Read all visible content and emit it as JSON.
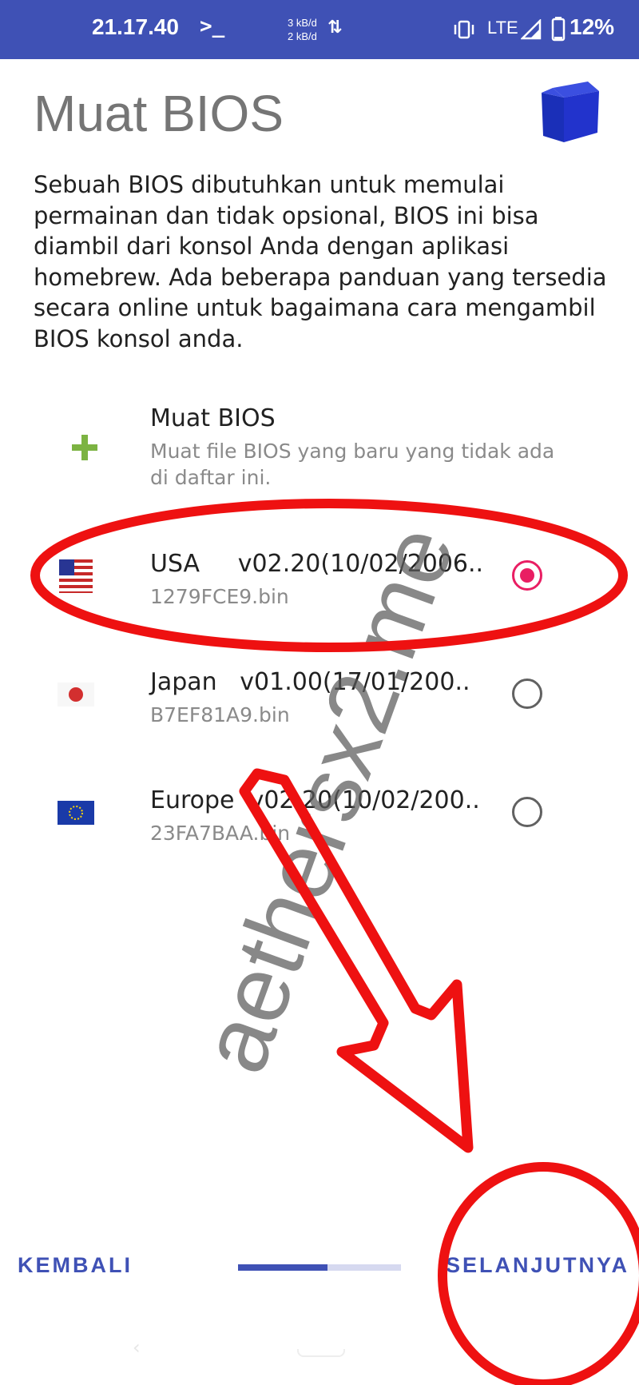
{
  "status_bar": {
    "time": "21.17.40",
    "terminal_glyph": ">_",
    "upload_speed": "3 kB/d",
    "download_speed": "2 kB/d",
    "network": "LTE",
    "battery": "12%",
    "icons": [
      "terminal-icon",
      "data-transfer-icon",
      "vibrate-icon",
      "signal-icon",
      "battery-icon"
    ]
  },
  "page": {
    "title": "Muat BIOS",
    "description": "Sebuah BIOS dibutuhkan untuk memulai permainan dan tidak opsional, BIOS ini bisa diambil dari konsol Anda dengan aplikasi homebrew. Ada beberapa panduan yang tersedia secara online untuk bagaimana cara mengambil BIOS konsol anda."
  },
  "load_item": {
    "title": "Muat BIOS",
    "subtitle": "Muat file BIOS yang baru yang tidak ada di daftar ini.",
    "icon": "plus-icon",
    "icon_color": "#7cb342"
  },
  "bios_list": [
    {
      "region": "USA",
      "title": "USA     v02.20(10/02/2006..",
      "file": "1279FCE9.bin",
      "selected": true,
      "flag": "usa-flag-icon"
    },
    {
      "region": "Japan",
      "title": "Japan   v01.00(17/01/200..",
      "file": "B7EF81A9.bin",
      "selected": false,
      "flag": "japan-flag-icon"
    },
    {
      "region": "Europe",
      "title": "Europe  v02.20(10/02/200..",
      "file": "23FA7BAA.bin",
      "selected": false,
      "flag": "eu-flag-icon"
    }
  ],
  "nav": {
    "back_label": "KEMBALI",
    "next_label": "SELANJUTNYA",
    "progress": 0.55
  },
  "watermark": "aethersx2.me",
  "colors": {
    "primary": "#3f51b5",
    "accent": "#e91e63",
    "annotation_red": "#ee1111"
  }
}
